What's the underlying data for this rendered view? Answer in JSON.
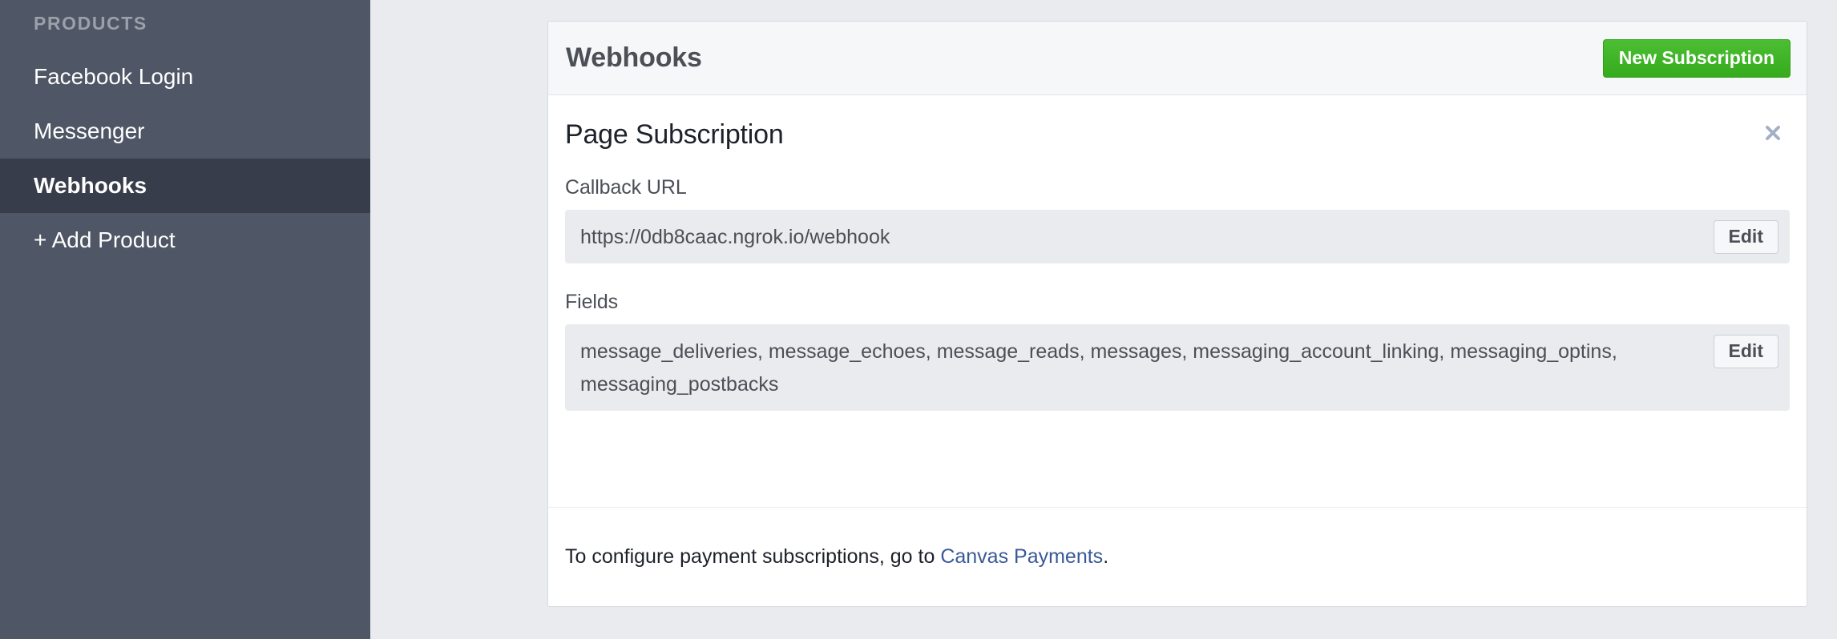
{
  "sidebar": {
    "section_title": "PRODUCTS",
    "items": [
      {
        "label": "Facebook Login",
        "active": false
      },
      {
        "label": "Messenger",
        "active": false
      },
      {
        "label": "Webhooks",
        "active": true
      },
      {
        "label": "+ Add Product",
        "active": false
      }
    ]
  },
  "panel": {
    "header": {
      "title": "Webhooks",
      "new_subscription_label": "New Subscription"
    },
    "subscription": {
      "title": "Page Subscription",
      "close_icon": "close-icon",
      "callback_url": {
        "label": "Callback URL",
        "value": "https://0db8caac.ngrok.io/webhook",
        "edit_label": "Edit"
      },
      "fields": {
        "label": "Fields",
        "value": "message_deliveries, message_echoes, message_reads, messages, messaging_account_linking, messaging_optins, messaging_postbacks",
        "list": [
          "message_deliveries",
          "message_echoes",
          "message_reads",
          "messages",
          "messaging_account_linking",
          "messaging_optins",
          "messaging_postbacks"
        ],
        "edit_label": "Edit"
      }
    },
    "footer": {
      "text_before": "To configure payment subscriptions, go to ",
      "link_label": "Canvas Payments",
      "text_after": "."
    }
  },
  "colors": {
    "sidebar_bg": "#4f5665",
    "sidebar_active_bg": "#373d4a",
    "page_bg": "#e9ebee",
    "panel_bg": "#ffffff",
    "panel_header_bg": "#f6f7f9",
    "primary_green": "#3cb521",
    "value_box_bg": "#e9ebee",
    "link_blue": "#3b5998",
    "close_icon": "#a3b0c6",
    "text_dark": "#1d2129",
    "text_muted": "#4b4f56",
    "section_label": "#9ba0aa"
  }
}
